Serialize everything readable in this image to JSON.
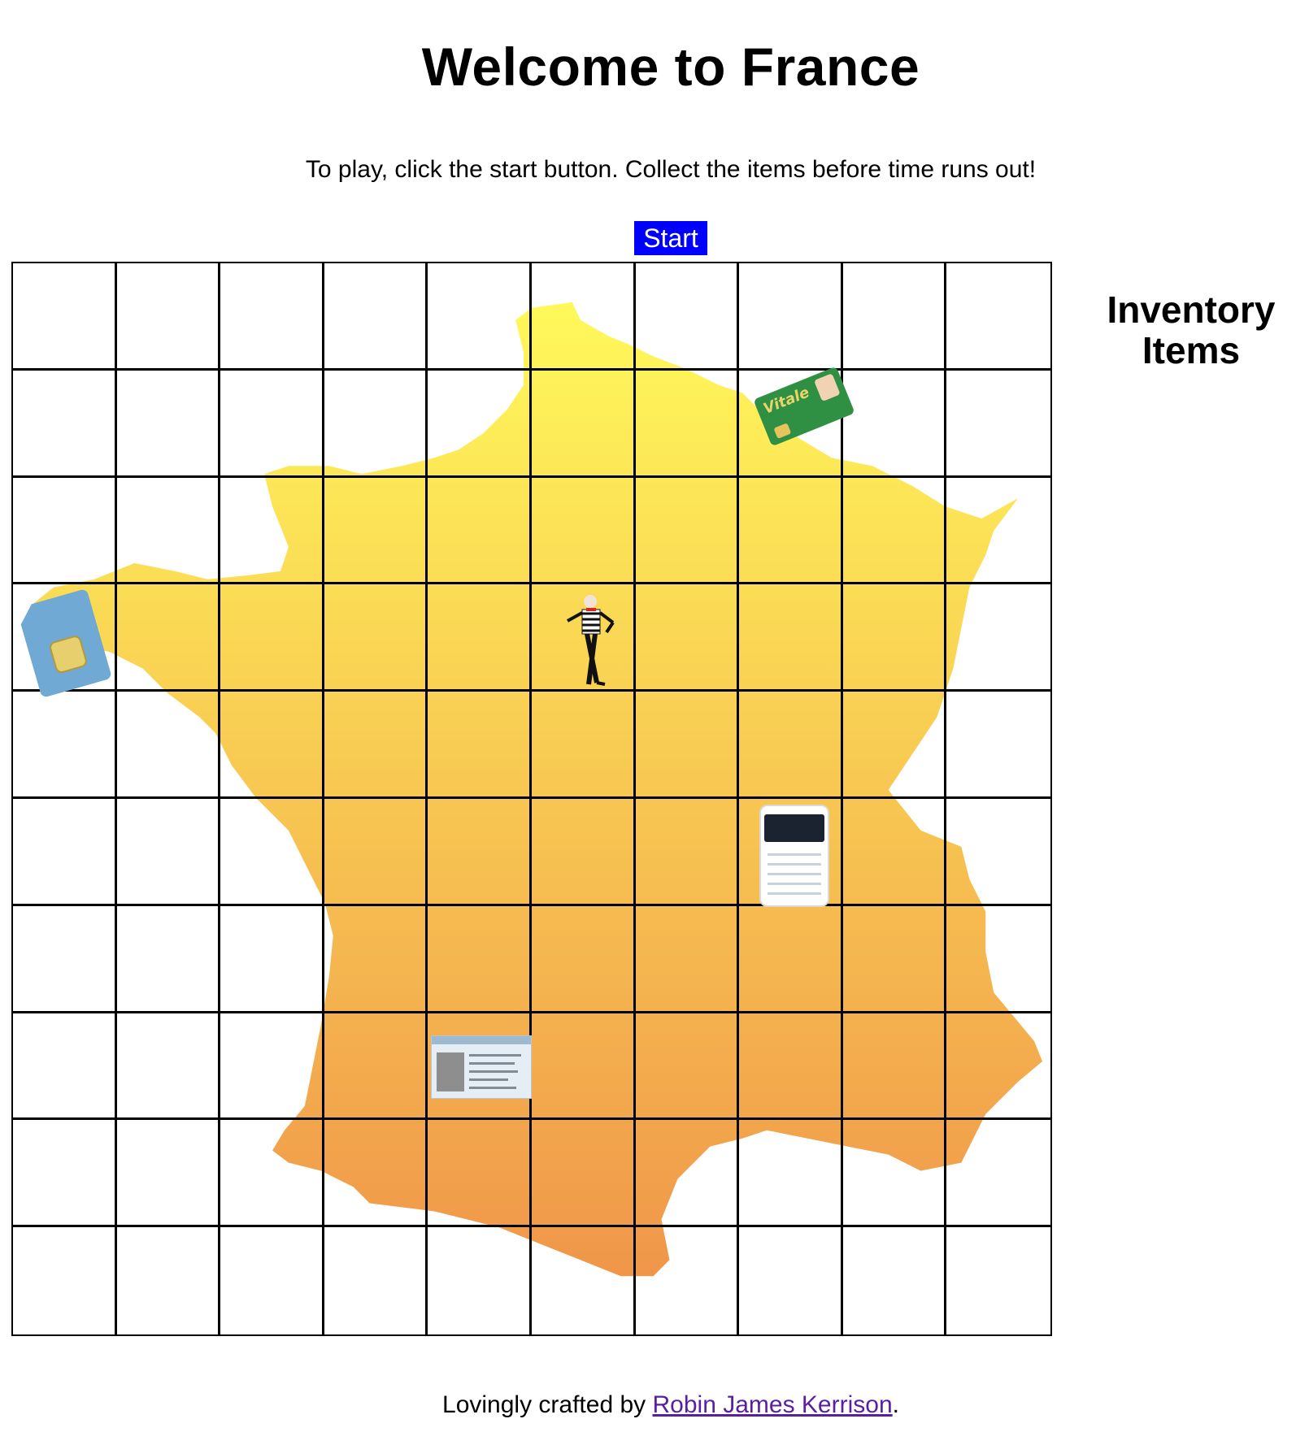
{
  "page": {
    "title": "Welcome to France",
    "instructions": "To play, click the start button. Collect the items before time runs out!",
    "start_label": "Start"
  },
  "board": {
    "rows": 10,
    "columns": 10,
    "map_colors": {
      "top": "#fff95a",
      "bottom": "#f0964a"
    },
    "pieces": [
      "sim-card",
      "carte-vitale",
      "mime-player",
      "banking-app-phone",
      "residence-permit-card"
    ]
  },
  "items": {
    "vitale_text": "Vitale"
  },
  "inventory": {
    "title": "Inventory Items",
    "items": []
  },
  "footer": {
    "prefix": "Lovingly crafted by ",
    "author_link": "Robin James Kerrison",
    "suffix": "."
  },
  "colors": {
    "start_button": "#0000ff",
    "link": "#5a1fa0"
  }
}
